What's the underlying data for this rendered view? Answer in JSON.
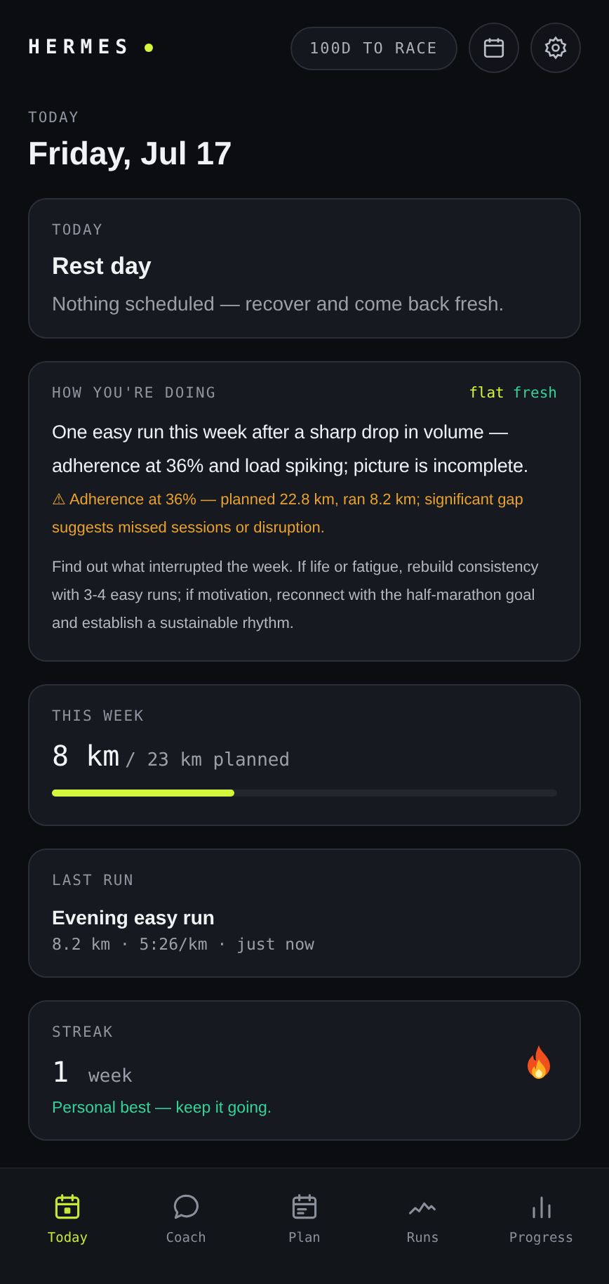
{
  "app": {
    "name": "HERMES"
  },
  "header": {
    "countdown": "100D TO RACE"
  },
  "page": {
    "eyebrow": "TODAY",
    "title": "Friday, Jul 17"
  },
  "today_card": {
    "label": "TODAY",
    "title": "Rest day",
    "text": "Nothing scheduled — recover and come back fresh."
  },
  "insight_card": {
    "label": "HOW YOU'RE DOING",
    "tags": [
      {
        "text": "flat",
        "color": "#d4f53c"
      },
      {
        "text": "fresh",
        "color": "#34d399"
      }
    ],
    "summary": "One easy run this week after a sharp drop in volume — adherence at 36% and load spiking; picture is incomplete.",
    "warning": "⚠ Adherence at 36% — planned 22.8 km, ran 8.2 km; significant gap suggests missed sessions or disruption.",
    "advice": "Find out what interrupted the week. If life or fatigue, rebuild consistency with 3-4 easy runs; if motivation, reconnect with the half-marathon goal and establish a sustainable rhythm."
  },
  "week_card": {
    "label": "THIS WEEK",
    "value": "8 km",
    "planned": "/ 23 km planned",
    "level": 0.36
  },
  "last_run_card": {
    "label": "LAST RUN",
    "title": "Evening easy run",
    "details": "8.2 km · 5:26/km · just now"
  },
  "streak_card": {
    "label": "STREAK",
    "value": "1",
    "unit": "week",
    "note": "Personal best — keep it going."
  },
  "nav": [
    {
      "label": "Today",
      "kind": "today",
      "selected": true
    },
    {
      "label": "Coach",
      "kind": "coach",
      "selected": false
    },
    {
      "label": "Plan",
      "kind": "plan",
      "selected": false
    },
    {
      "label": "Runs",
      "kind": "runs",
      "selected": false
    },
    {
      "label": "Progress",
      "kind": "progress",
      "selected": false
    }
  ]
}
